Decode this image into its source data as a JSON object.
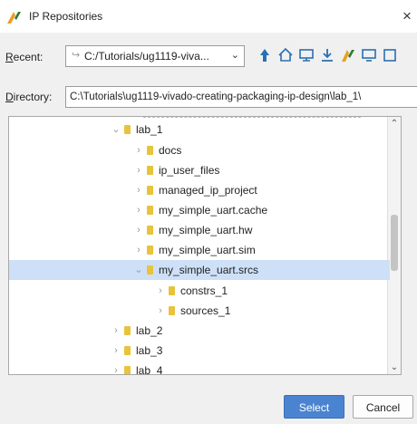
{
  "window": {
    "title": "IP Repositories",
    "app_icon": "vivado-icon",
    "close_label": "×"
  },
  "recent": {
    "label": "Recent:",
    "mnemonic": "R",
    "label_rest": "ecent:",
    "value": "C:/Tutorials/ug1119-viva...",
    "dropdown_icon": "chevron-down-icon"
  },
  "toolbar": {
    "icons": [
      "up-arrow-icon",
      "home-icon",
      "desktop-icon",
      "download-icon",
      "vivado-project-icon",
      "monitor-icon",
      "new-folder-icon"
    ]
  },
  "directory": {
    "label": "Directory:",
    "mnemonic": "D",
    "label_rest": "irectory:",
    "value": "C:\\Tutorials\\ug1119-vivado-creating-packaging-ip-design\\lab_1\\"
  },
  "tree": {
    "rows": [
      {
        "name": "lab_1",
        "expanded": true,
        "selected": false
      },
      {
        "name": "docs",
        "expanded": false,
        "selected": false
      },
      {
        "name": "ip_user_files",
        "expanded": false,
        "selected": false
      },
      {
        "name": "managed_ip_project",
        "expanded": false,
        "selected": false
      },
      {
        "name": "my_simple_uart.cache",
        "expanded": false,
        "selected": false
      },
      {
        "name": "my_simple_uart.hw",
        "expanded": false,
        "selected": false
      },
      {
        "name": "my_simple_uart.sim",
        "expanded": false,
        "selected": false
      },
      {
        "name": "my_simple_uart.srcs",
        "expanded": true,
        "selected": true
      },
      {
        "name": "constrs_1",
        "expanded": false,
        "selected": false
      },
      {
        "name": "sources_1",
        "expanded": false,
        "selected": false
      },
      {
        "name": "lab_2",
        "expanded": false,
        "selected": false
      },
      {
        "name": "lab_3",
        "expanded": false,
        "selected": false
      },
      {
        "name": "lab_4",
        "expanded": false,
        "selected": false
      }
    ]
  },
  "buttons": {
    "select": "Select",
    "cancel": "Cancel"
  },
  "colors": {
    "accent": "#4a84d1",
    "selection": "#cde0f7",
    "folder": "#e8c33b"
  }
}
